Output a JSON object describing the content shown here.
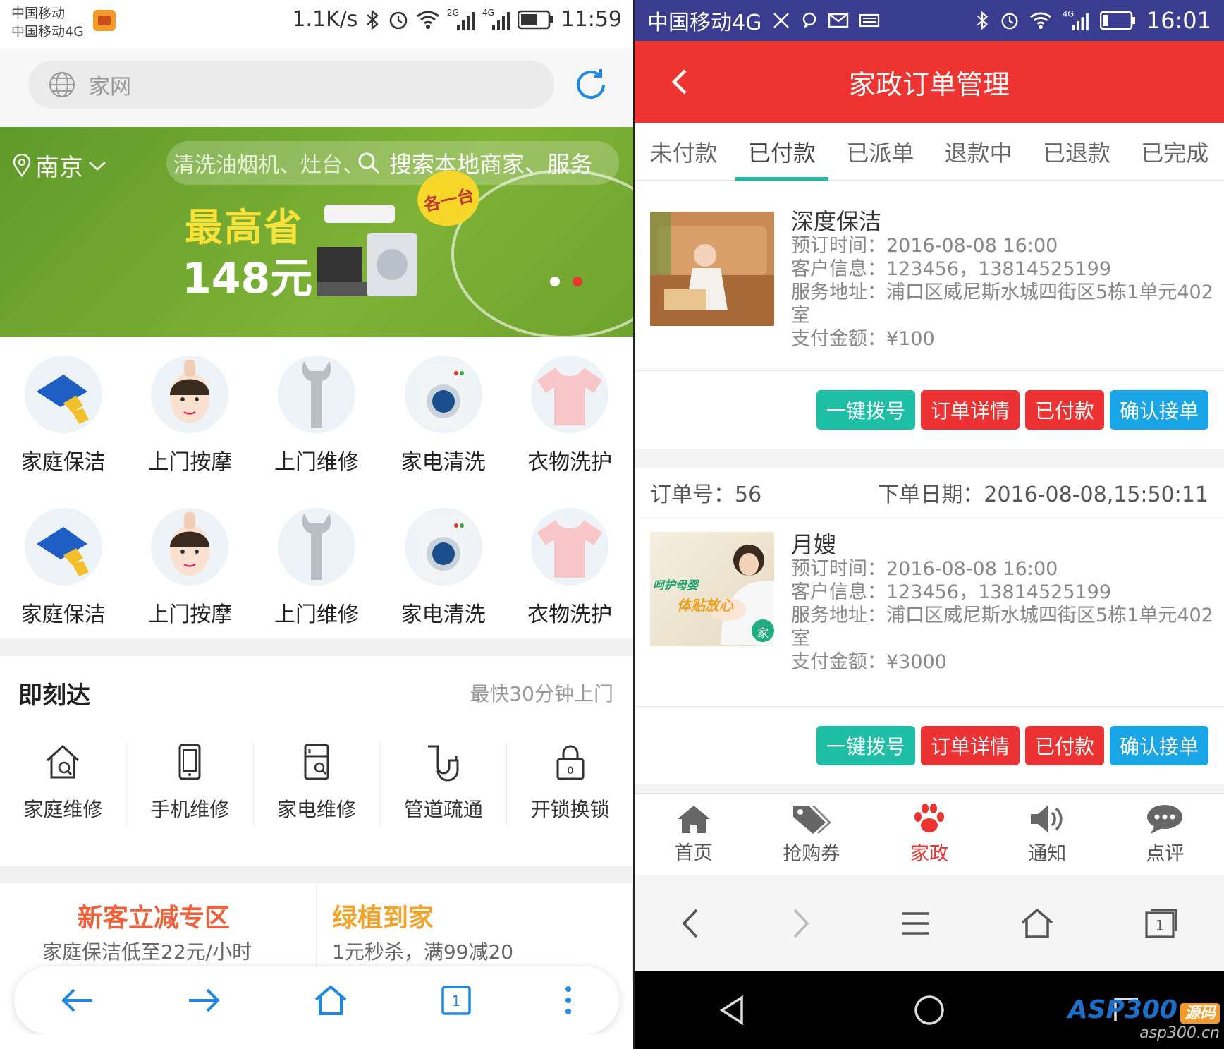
{
  "left": {
    "status": {
      "carrier1": "中国移动",
      "carrier2": "中国移动4G",
      "speed": "1.1K/s",
      "net1": "2G",
      "net2": "4G",
      "time": "11:59"
    },
    "url": {
      "placeholder": "家网"
    },
    "banner": {
      "city": "南京",
      "search_ph": "清洗油烟机、灶台、",
      "search_hint": "搜索本地商家、服务",
      "promo1": "最高省",
      "promo2": "148元",
      "badge": "各一台"
    },
    "categories_row1": [
      "家庭保洁",
      "上门按摩",
      "上门维修",
      "家电清洗",
      "衣物洗护"
    ],
    "categories_row2": [
      "家庭保洁",
      "上门按摩",
      "上门维修",
      "家电清洗",
      "衣物洗护"
    ],
    "jkd": {
      "title": "即刻达",
      "sub": "最快30分钟上门",
      "items": [
        "家庭维修",
        "手机维修",
        "家电维修",
        "管道疏通",
        "开锁换锁"
      ]
    },
    "cards": [
      {
        "title": "新客立减专区",
        "sub": "家庭保洁低至22元/小时",
        "color": "#f0603a"
      },
      {
        "title": "绿植到家",
        "sub": "1元秒杀，满99减20",
        "color": "#f2a42a"
      }
    ],
    "toolbar": {
      "tab_count": "1"
    }
  },
  "right": {
    "status": {
      "carrier": "中国移动4G",
      "net": "4G",
      "time": "16:01"
    },
    "header": {
      "title": "家政订单管理"
    },
    "tabs": [
      "未付款",
      "已付款",
      "已派单",
      "退款中",
      "已退款",
      "已完成"
    ],
    "active_tab": "已付款",
    "orders": [
      {
        "order_no": "",
        "order_date": "",
        "service": "深度保洁",
        "time_label": "预订时间：",
        "time": "2016-08-08 16:00",
        "client_label": "客户信息：",
        "client": "123456，13814525199",
        "addr_label": "服务地址：",
        "addr": "浦口区威尼斯水城四街区5栋1单元402室",
        "pay_label": "支付金额：",
        "pay": "¥100"
      },
      {
        "order_no_label": "订单号：",
        "order_no": "56",
        "order_date_label": "下单日期：",
        "order_date": "2016-08-08,15:50:11",
        "service": "月嫂",
        "time_label": "预订时间：",
        "time": "2016-08-08 16:00",
        "client_label": "客户信息：",
        "client": "123456，13814525199",
        "addr_label": "服务地址：",
        "addr": "浦口区威尼斯水城四街区5栋1单元402室",
        "pay_label": "支付金额：",
        "pay": "¥3000",
        "thumb_text1": "呵护母婴",
        "thumb_text2": "体贴放心",
        "thumb_badge": "家"
      }
    ],
    "buttons": {
      "call": "一键拨号",
      "detail": "订单详情",
      "paid": "已付款",
      "accept": "确认接单"
    },
    "nav": [
      "首页",
      "抢购券",
      "家政",
      "通知",
      "点评"
    ],
    "nav_active": "家政",
    "browser": {
      "tab_count": "1"
    },
    "watermark": {
      "brand": "ASP300",
      "tag": "源码",
      "domain": "asp300.cn"
    }
  },
  "colors": {
    "red": "#ee3430",
    "teal": "#1fbfa6",
    "blue": "#1aa6e6",
    "status_bar": "#3a3d8f",
    "banner_green": "#6ea32e"
  }
}
